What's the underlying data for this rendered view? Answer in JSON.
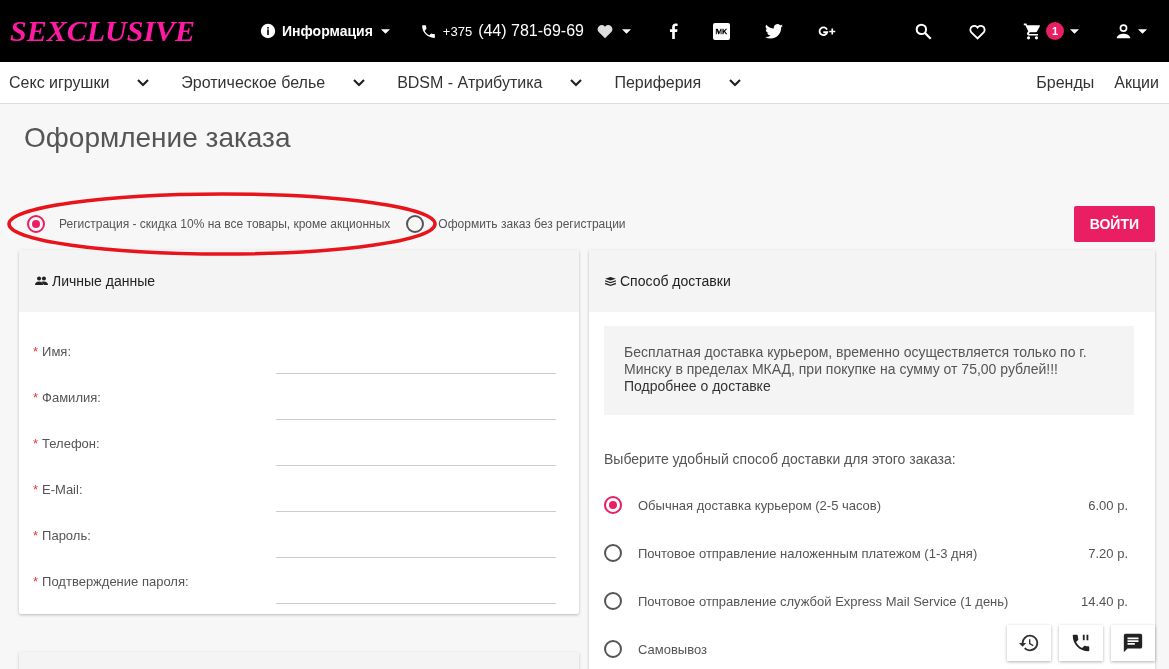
{
  "header": {
    "logo": "SEXCLUSIVE",
    "info_menu": "Информация",
    "phone_code": "+375",
    "phone_number": "(44) 781-69-69",
    "cart_count": "1"
  },
  "nav": {
    "categories": [
      "Секс игрушки",
      "Эротическое белье",
      "BDSM - Атрибутика",
      "Периферия"
    ],
    "links": [
      "Бренды",
      "Акции"
    ]
  },
  "page_title": "Оформление заказа",
  "checkout_mode": [
    {
      "label": "Регистрация - скидка 10% на все товары, кроме акционных",
      "selected": true
    },
    {
      "label": "Оформить заказ без регистрации",
      "selected": false
    }
  ],
  "login_button": "ВОЙТИ",
  "personal": {
    "title": "Личные данные",
    "required_mark": "*",
    "fields": [
      {
        "label": "Имя:",
        "required": true
      },
      {
        "label": "Фамилия:",
        "required": true
      },
      {
        "label": "Телефон:",
        "required": true
      },
      {
        "label": "E-Mail:",
        "required": true
      },
      {
        "label": "Пароль:",
        "required": true
      },
      {
        "label": "Подтверждение пароля:",
        "required": true
      }
    ]
  },
  "delivery": {
    "title": "Способ доставки",
    "notice": "Бесплатная доставка курьером, временно осуществляется только по г. Минску в пределах МКАД, при покупке на сумму от 75,00 рублей!!!",
    "notice_link": "Подробнее о доставке",
    "prompt": "Выберите удобный способ доставки для этого заказа:",
    "options": [
      {
        "label": "Обычная доставка курьером (2-5 часов)",
        "price": "6.00 р.",
        "selected": true
      },
      {
        "label": "Почтовое отправление наложенным платежом (1-3 дня)",
        "price": "7.20 р.",
        "selected": false
      },
      {
        "label": "Почтовое отправление службой Express Mail Service (1 день)",
        "price": "14.40 р.",
        "selected": false
      },
      {
        "label": "Самовывоз",
        "selected": false
      }
    ]
  }
}
